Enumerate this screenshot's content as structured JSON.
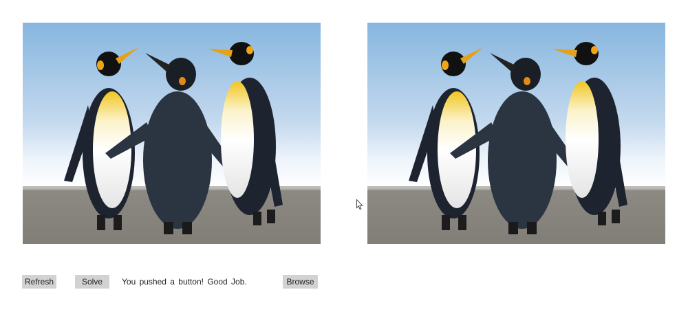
{
  "images": {
    "left": {
      "subject": "penguins-photo",
      "label": ""
    },
    "right": {
      "subject": "penguins-photo",
      "label": ""
    }
  },
  "toolbar": {
    "refresh_label": "Refresh",
    "solve_label": "Solve",
    "status_text": "You pushed a button! Good Job.",
    "browse_label": "Browse"
  },
  "icons": {
    "pointer": "mouse-pointer-icon"
  },
  "colors": {
    "button_bg": "#d2d2d2",
    "text": "#222222",
    "sky": "#aac9e6",
    "sand": "#9a968f"
  }
}
